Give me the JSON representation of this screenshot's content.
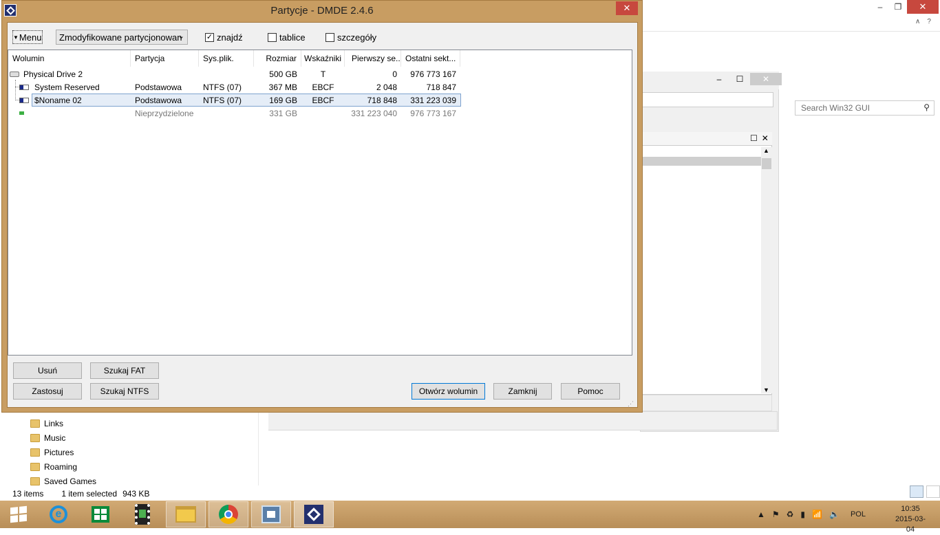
{
  "explorer": {
    "search_placeholder": "Search Win32 GUI",
    "nav_items": [
      "Links",
      "Music",
      "Pictures",
      "Roaming",
      "Saved Games"
    ],
    "status_items": "13 items",
    "status_selected": "1 item selected",
    "status_size": "943 KB"
  },
  "dialog": {
    "title": "Partycje - DMDE 2.4.6",
    "menu_label": "Menu",
    "combo_value": "Zmodyfikowane partycjonowan",
    "checkboxes": [
      {
        "label": "znajdź",
        "checked": true
      },
      {
        "label": "tablice",
        "checked": false
      },
      {
        "label": "szczegóły",
        "checked": false
      }
    ],
    "columns": [
      "Wolumin",
      "Partycja",
      "Sys.plik.",
      "Rozmiar",
      "Wskaźniki",
      "Pierwszy se...",
      "Ostatni sekt..."
    ],
    "rows": [
      {
        "volume": "Physical Drive 2",
        "partition": "",
        "fs": "",
        "size": "500 GB",
        "flags": "T",
        "first": "0",
        "last": "976 773 167"
      },
      {
        "volume": "System Reserved",
        "partition": "Podstawowa",
        "fs": "NTFS (07)",
        "size": "367 MB",
        "flags": "EBCF",
        "first": "2 048",
        "last": "718 847"
      },
      {
        "volume": "$Noname 02",
        "partition": "Podstawowa",
        "fs": "NTFS (07)",
        "size": "169 GB",
        "flags": "EBCF",
        "first": "718 848",
        "last": "331 223 039"
      },
      {
        "volume": "",
        "partition": "Nieprzydzielone",
        "fs": "",
        "size": "331 GB",
        "flags": "",
        "first": "331 223 040",
        "last": "976 773 167"
      }
    ],
    "buttons": {
      "delete": "Usuń",
      "search_fat": "Szukaj FAT",
      "apply": "Zastosuj",
      "search_ntfs": "Szukaj NTFS",
      "open_volume": "Otwórz wolumin",
      "close": "Zamknij",
      "help": "Pomoc"
    }
  },
  "taskbar": {
    "language": "POL",
    "time": "10:35",
    "date": "2015-03-04"
  }
}
